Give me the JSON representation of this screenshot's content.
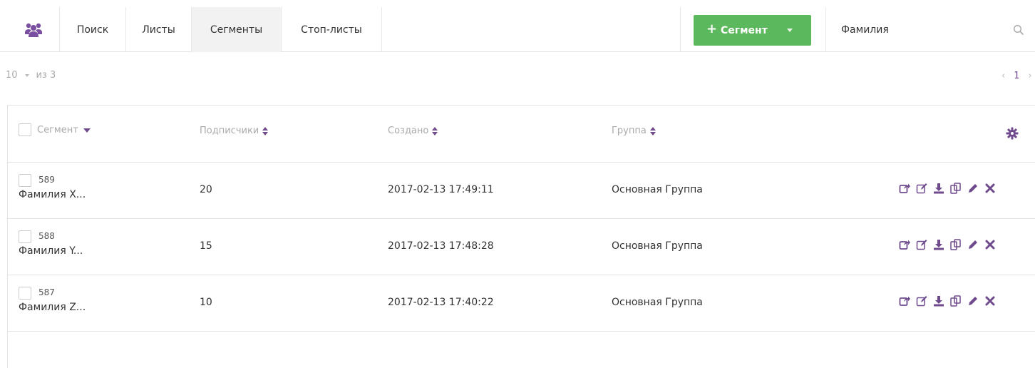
{
  "nav": {
    "items": [
      {
        "label": "Поиск"
      },
      {
        "label": "Листы"
      },
      {
        "label": "Сегменты"
      },
      {
        "label": "Стоп-листы"
      }
    ],
    "active": "Сегменты"
  },
  "add_button": {
    "label": "Сегмент",
    "icon": "plus-icon"
  },
  "search": {
    "value": "Фамилия",
    "placeholder": ""
  },
  "pager": {
    "per_page": "10",
    "total": "из 3",
    "current_page": "1"
  },
  "table": {
    "columns": [
      {
        "label": "Сегмент"
      },
      {
        "label": "Подписчики"
      },
      {
        "label": "Создано"
      },
      {
        "label": "Группа"
      }
    ],
    "rows": [
      {
        "id": "589",
        "name": "Фамилия X...",
        "subscribers": "20",
        "created": "2017-02-13 17:49:11",
        "group": "Основная Группа"
      },
      {
        "id": "588",
        "name": "Фамилия Y...",
        "subscribers": "15",
        "created": "2017-02-13 17:48:28",
        "group": "Основная Группа"
      },
      {
        "id": "587",
        "name": "Фамилия Z...",
        "subscribers": "10",
        "created": "2017-02-13 17:40:22",
        "group": "Основная Группа"
      }
    ],
    "row_actions": [
      "share-icon",
      "edit-icon",
      "download-icon",
      "copy-icon",
      "pencil-icon",
      "delete-icon"
    ]
  },
  "colors": {
    "accent": "#6f4a8c",
    "primary_button": "#5cb85c",
    "border": "#e3e3e3"
  }
}
